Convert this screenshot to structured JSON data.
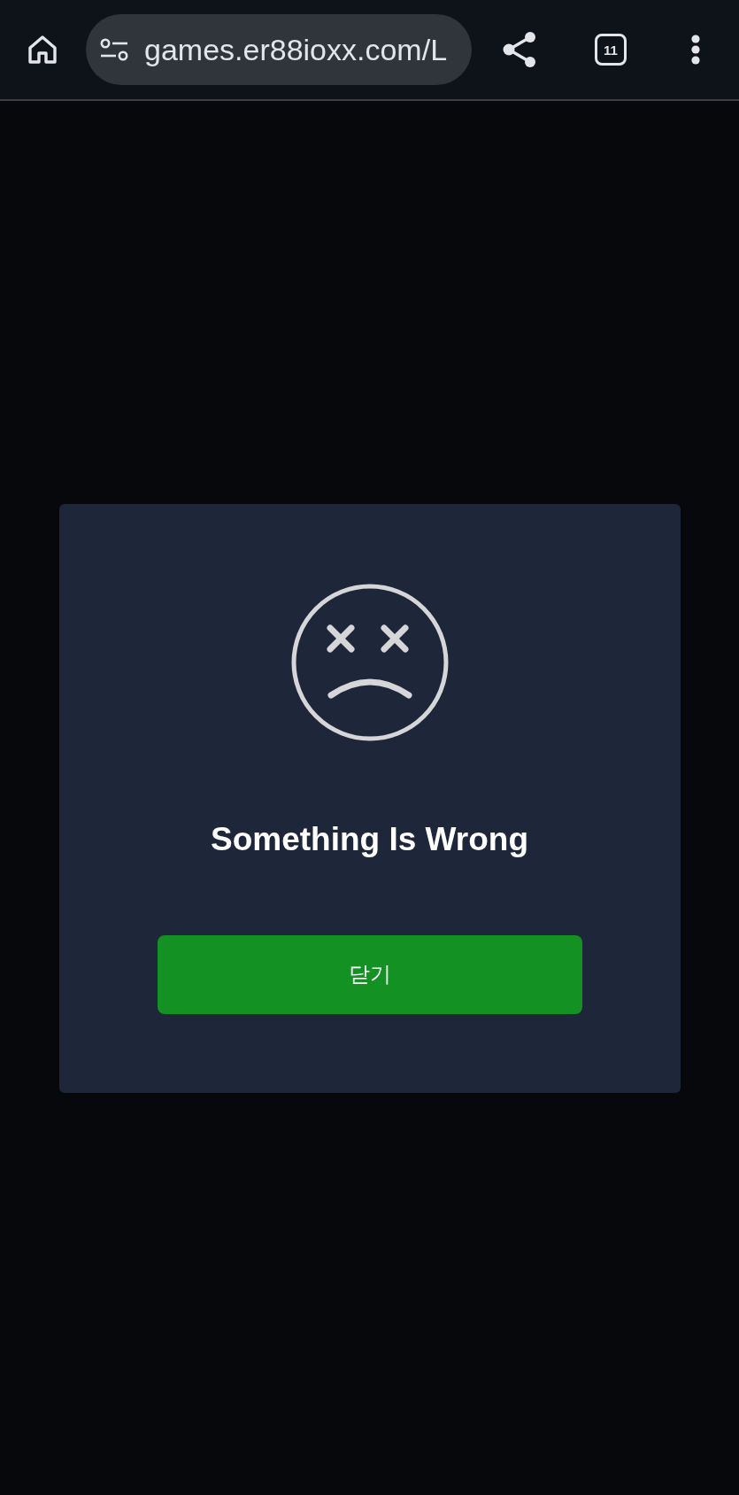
{
  "browser_bar": {
    "url": "games.er88ioxx.com/L",
    "tab_count": "11"
  },
  "dialog": {
    "title": "Something Is Wrong",
    "buttons": [
      {
        "label": "닫기",
        "kind": "primary"
      }
    ]
  }
}
